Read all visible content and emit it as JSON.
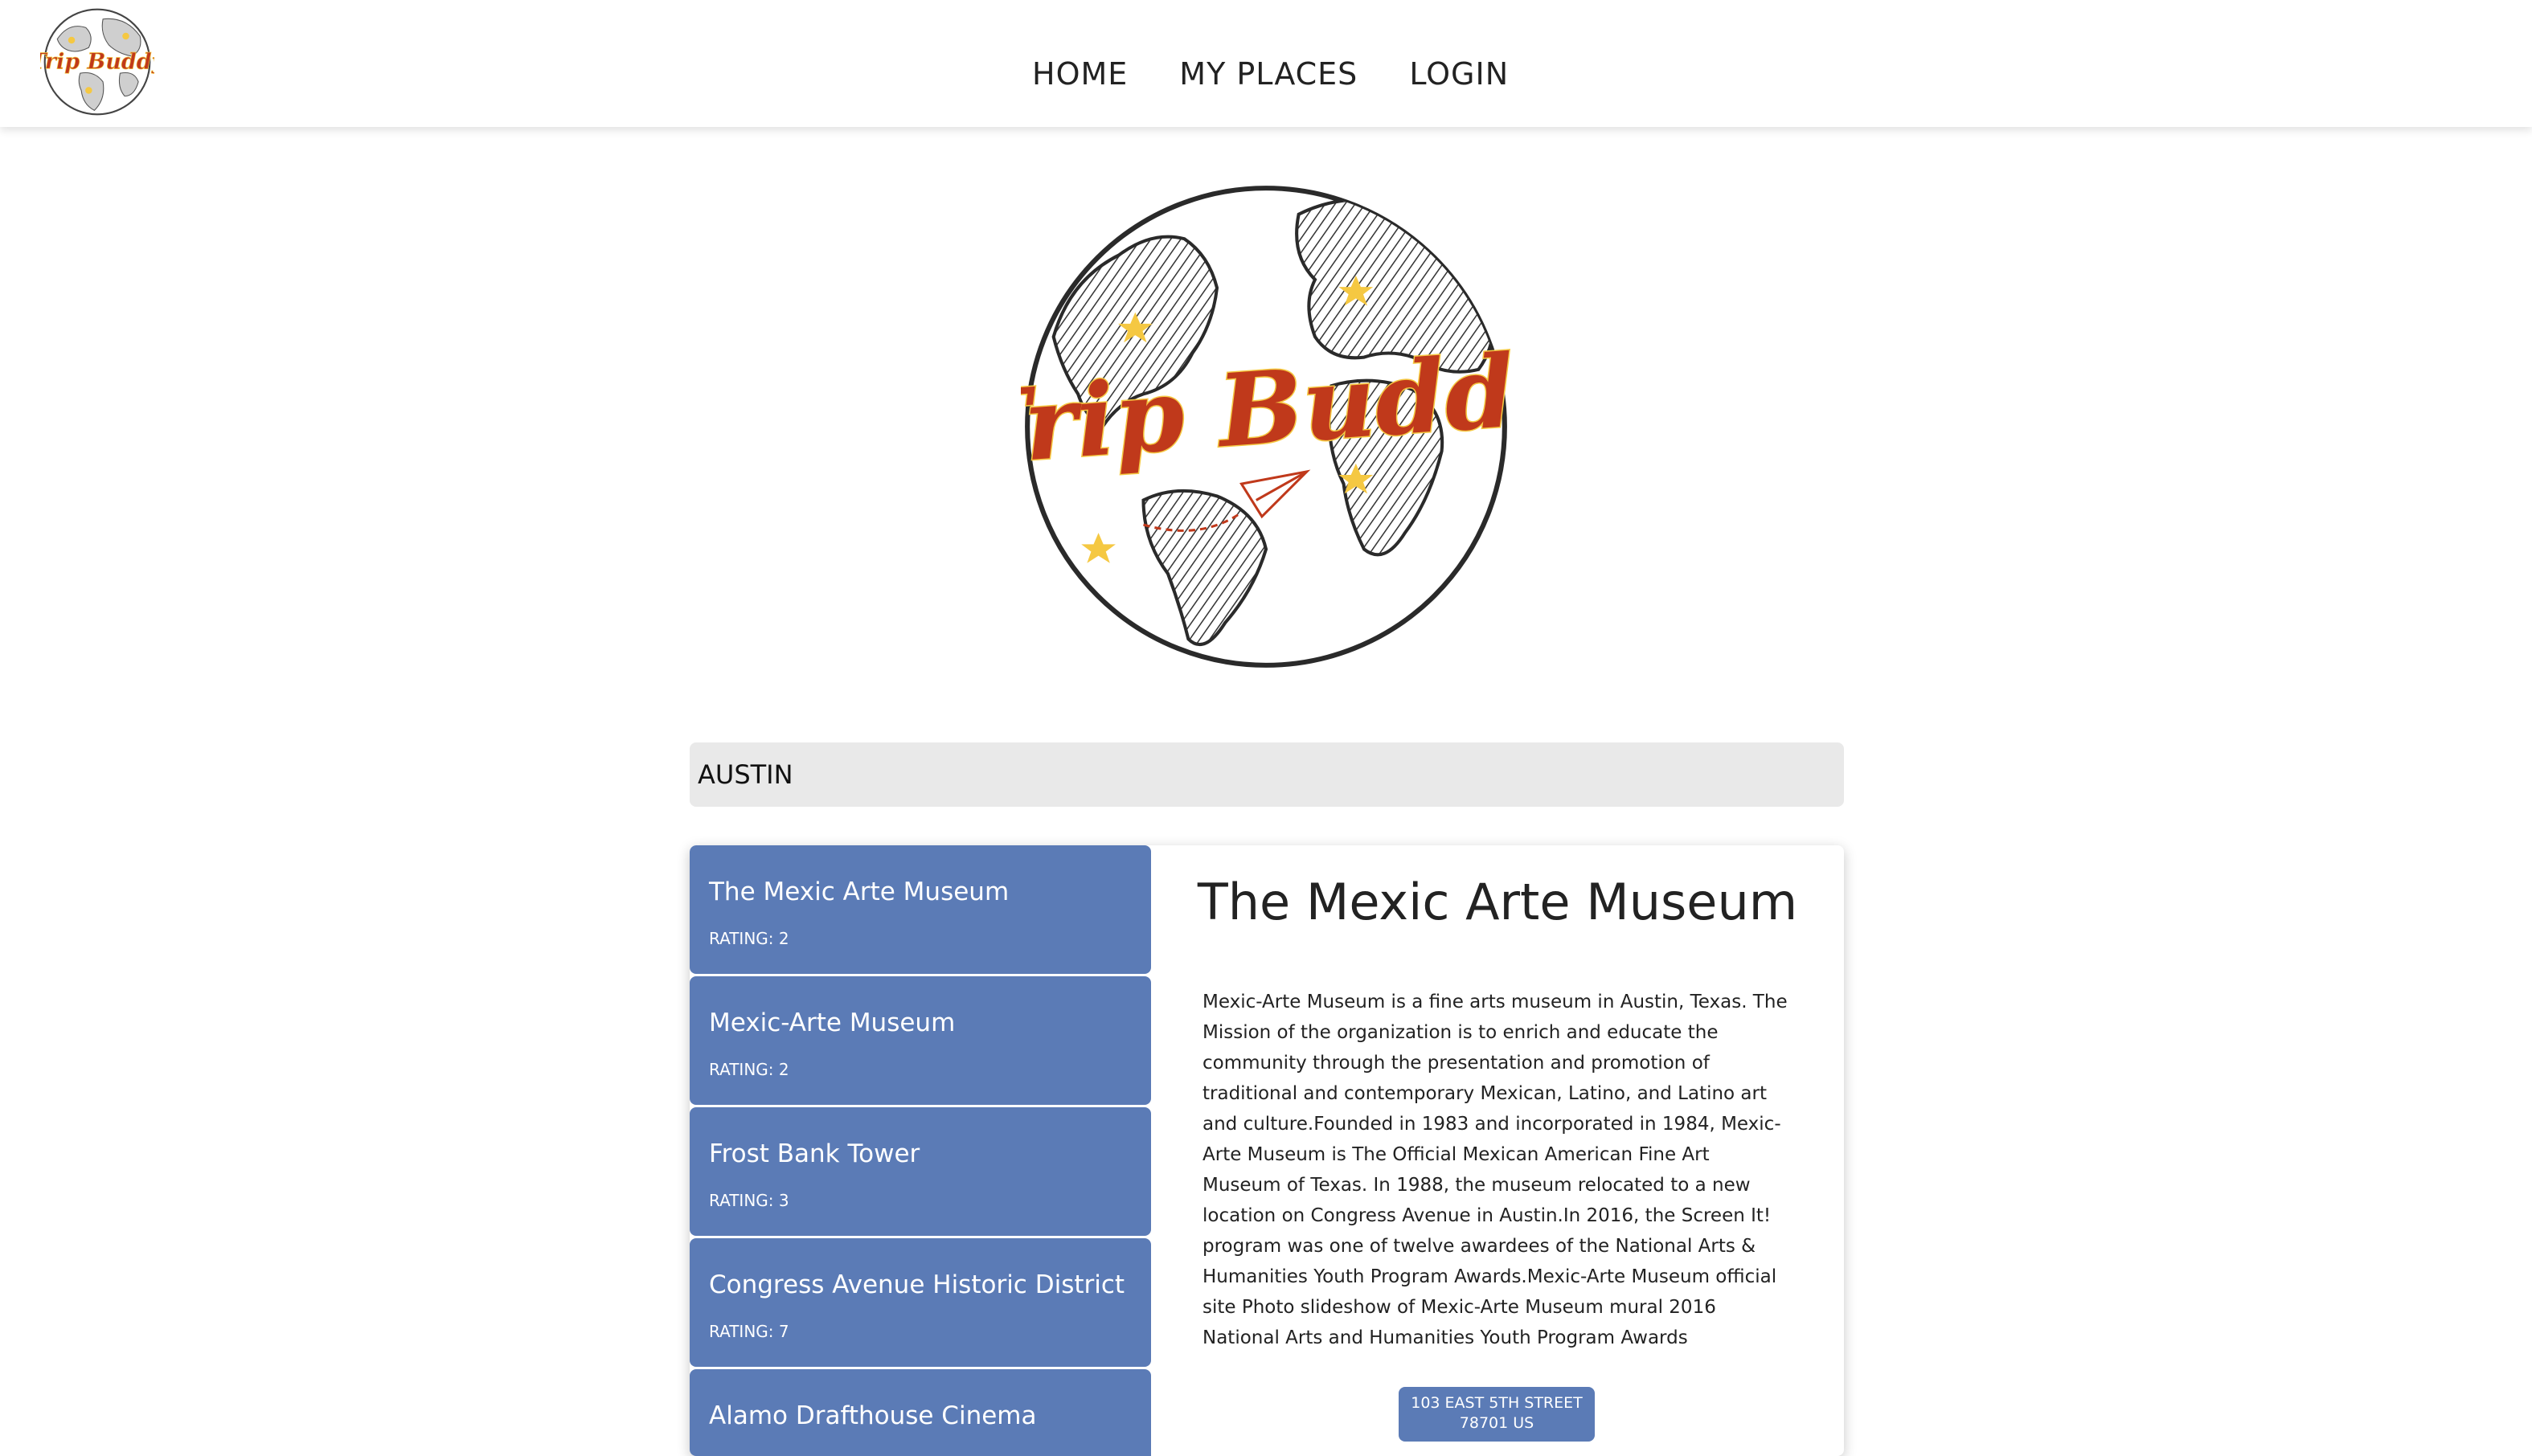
{
  "brand": {
    "name": "Trip Buddy",
    "colors": {
      "accent": "#c0391b",
      "star": "#f5c842",
      "card": "#5b7bb6",
      "search_bg": "#e9e9e9"
    }
  },
  "nav": {
    "home": "HOME",
    "my_places": "MY PLACES",
    "login": "LOGIN"
  },
  "search": {
    "value": "AUSTIN"
  },
  "places": [
    {
      "name": "The Mexic Arte Museum",
      "rating": "RATING: 2"
    },
    {
      "name": "Mexic-Arte Museum",
      "rating": "RATING: 2"
    },
    {
      "name": "Frost Bank Tower",
      "rating": "RATING: 3"
    },
    {
      "name": "Congress Avenue Historic District",
      "rating": "RATING: 7"
    },
    {
      "name": "Alamo Drafthouse Cinema",
      "rating": ""
    }
  ],
  "detail": {
    "title": "The Mexic Arte Museum",
    "description": "Mexic-Arte Museum is a fine arts museum in Austin, Texas. The Mission of the organization is to enrich and educate the community through the presentation and promotion of traditional and contemporary Mexican, Latino, and Latino art and culture.Founded in 1983 and incorporated in 1984, Mexic-Arte Museum is The Official Mexican American Fine Art Museum of Texas. In 1988, the museum relocated to a new location on Congress Avenue in Austin.In 2016, the Screen It! program was one of twelve awardees of the National Arts & Humanities Youth Program Awards.Mexic-Arte Museum official site Photo slideshow of Mexic-Arte Museum mural 2016 National Arts and Humanities Youth Program Awards",
    "address_line1": "103 EAST 5TH STREET",
    "address_line2": "78701 US"
  }
}
